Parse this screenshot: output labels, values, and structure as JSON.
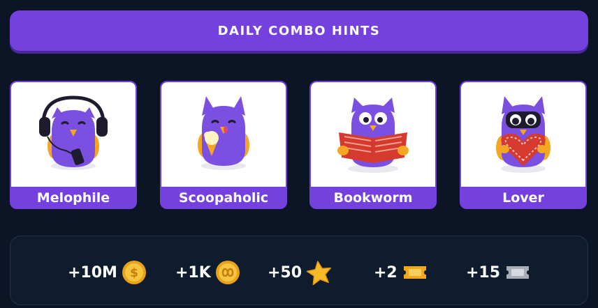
{
  "header": {
    "title": "DAILY COMBO HINTS"
  },
  "cards": [
    {
      "label": "Melophile",
      "icon": "owl-headphones-icon"
    },
    {
      "label": "Scoopaholic",
      "icon": "owl-icecream-icon"
    },
    {
      "label": "Bookworm",
      "icon": "owl-book-icon"
    },
    {
      "label": "Lover",
      "icon": "owl-heart-icon"
    }
  ],
  "rewards": [
    {
      "amount": "+10M",
      "icon": "coin-icon"
    },
    {
      "amount": "+1K",
      "icon": "infinity-coin-icon"
    },
    {
      "amount": "+50",
      "icon": "star-icon"
    },
    {
      "amount": "+2",
      "icon": "gold-ticket-icon"
    },
    {
      "amount": "+15",
      "icon": "silver-ticket-icon"
    }
  ],
  "colors": {
    "accent": "#7441de",
    "background": "#0b1526",
    "owl_body": "#7b4fe0",
    "owl_wing": "#f5a623"
  }
}
